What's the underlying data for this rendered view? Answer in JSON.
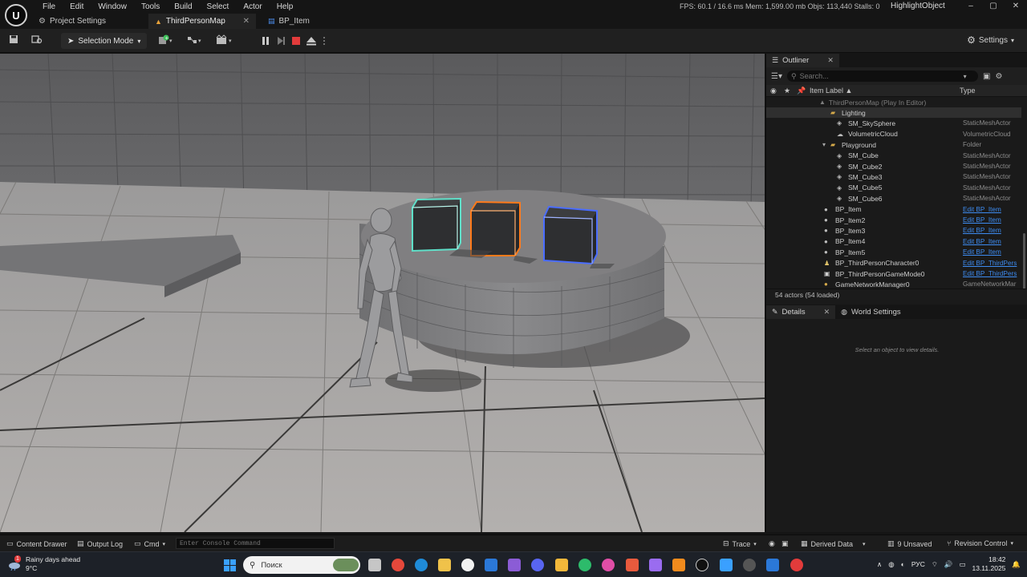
{
  "app": {
    "logo_text": "U",
    "menu": [
      "File",
      "Edit",
      "Window",
      "Tools",
      "Build",
      "Select",
      "Actor",
      "Help"
    ],
    "stats": "FPS: 60.1 / 16.6 ms  Mem: 1,599.00 mb  Objs: 113,440  Stalls: 0",
    "project_name": "HighlightObject",
    "window_controls": {
      "minimize": "–",
      "maximize": "▢",
      "close": "✕"
    }
  },
  "tabs": {
    "project_settings": "Project Settings",
    "third_person_map": "ThirdPersonMap",
    "bp_item": "BP_Item",
    "close": "✕"
  },
  "toolbar": {
    "selection_mode": "Selection Mode",
    "settings": "Settings"
  },
  "outliner": {
    "tab_label": "Outliner",
    "tab_close": "✕",
    "search_placeholder": "Search...",
    "col_label": "Item Label ▲",
    "col_type": "Type",
    "root": "ThirdPersonMap (Play In Editor)",
    "items": [
      {
        "label": "Lighting",
        "type": "",
        "kind": "folder",
        "indent": 1,
        "selected": true
      },
      {
        "label": "SM_SkySphere",
        "type": "StaticMeshActor",
        "kind": "mesh",
        "indent": 2
      },
      {
        "label": "VolumetricCloud",
        "type": "VolumetricCloud",
        "kind": "cloud",
        "indent": 2
      },
      {
        "label": "Playground",
        "type": "Folder",
        "kind": "folder",
        "indent": 1
      },
      {
        "label": "SM_Cube",
        "type": "StaticMeshActor",
        "kind": "mesh",
        "indent": 2
      },
      {
        "label": "SM_Cube2",
        "type": "StaticMeshActor",
        "kind": "mesh",
        "indent": 2
      },
      {
        "label": "SM_Cube3",
        "type": "StaticMeshActor",
        "kind": "mesh",
        "indent": 2
      },
      {
        "label": "SM_Cube5",
        "type": "StaticMeshActor",
        "kind": "mesh",
        "indent": 2
      },
      {
        "label": "SM_Cube6",
        "type": "StaticMeshActor",
        "kind": "mesh",
        "indent": 2
      },
      {
        "label": "BP_Item",
        "type": "Edit BP_Item",
        "kind": "bp",
        "indent": 0
      },
      {
        "label": "BP_Item2",
        "type": "Edit BP_Item",
        "kind": "bp",
        "indent": 0
      },
      {
        "label": "BP_Item3",
        "type": "Edit BP_Item",
        "kind": "bp",
        "indent": 0
      },
      {
        "label": "BP_Item4",
        "type": "Edit BP_Item",
        "kind": "bp",
        "indent": 0
      },
      {
        "label": "BP_Item5",
        "type": "Edit BP_Item",
        "kind": "bp",
        "indent": 0
      },
      {
        "label": "BP_ThirdPersonCharacter0",
        "type": "Edit BP_ThirdPers",
        "kind": "char",
        "indent": 0
      },
      {
        "label": "BP_ThirdPersonGameMode0",
        "type": "Edit BP_ThirdPers",
        "kind": "mode",
        "indent": 0
      },
      {
        "label": "GameNetworkManager0",
        "type": "GameNetworkMar",
        "kind": "net",
        "indent": 0
      }
    ],
    "actor_count": "54 actors (54 loaded)"
  },
  "details": {
    "tab_label": "Details",
    "tab_close": "✕",
    "world_settings": "World Settings",
    "empty_text": "Select an object to view details."
  },
  "statusbar": {
    "content_drawer": "Content Drawer",
    "output_log": "Output Log",
    "cmd": "Cmd",
    "console_placeholder": "Enter Console Command",
    "trace": "Trace",
    "derived_data": "Derived Data",
    "unsaved": "9 Unsaved",
    "revision_control": "Revision Control"
  },
  "taskbar": {
    "weather_title": "Rainy days ahead",
    "weather_temp": "9°C",
    "weather_badge": "1",
    "search_placeholder": "Поиск",
    "language": "РУС",
    "time": "18:42",
    "date": "13.11.2025"
  },
  "colors": {
    "accent_blue": "#3d8bf0",
    "cube_outline_teal": "#5fe0c9",
    "cube_outline_orange": "#ff7a1a",
    "cube_outline_blue": "#4a6dff"
  }
}
